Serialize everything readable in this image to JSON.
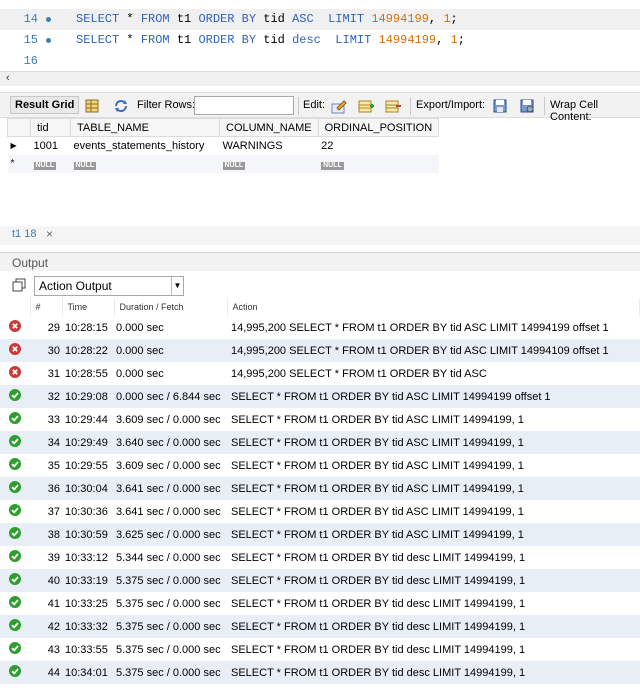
{
  "editor": {
    "lines": [
      {
        "num": "14",
        "dot": true,
        "parts": [
          {
            "t": "SELECT",
            "c": "kw"
          },
          {
            "t": " * ",
            "c": ""
          },
          {
            "t": "FROM",
            "c": "kw"
          },
          {
            "t": " t1 ",
            "c": ""
          },
          {
            "t": "ORDER BY",
            "c": "kw"
          },
          {
            "t": " tid ",
            "c": ""
          },
          {
            "t": "ASC",
            "c": "kw"
          },
          {
            "t": "  ",
            "c": ""
          },
          {
            "t": "LIMIT",
            "c": "kw"
          },
          {
            "t": " ",
            "c": ""
          },
          {
            "t": "14994199",
            "c": "num"
          },
          {
            "t": ", ",
            "c": ""
          },
          {
            "t": "1",
            "c": "num"
          },
          {
            "t": ";",
            "c": ""
          }
        ]
      },
      {
        "num": "15",
        "dot": true,
        "parts": [
          {
            "t": "SELECT",
            "c": "kw"
          },
          {
            "t": " * ",
            "c": ""
          },
          {
            "t": "FROM",
            "c": "kw"
          },
          {
            "t": " t1 ",
            "c": ""
          },
          {
            "t": "ORDER BY",
            "c": "kw"
          },
          {
            "t": " tid ",
            "c": ""
          },
          {
            "t": "desc",
            "c": "kw"
          },
          {
            "t": "  ",
            "c": ""
          },
          {
            "t": "LIMIT",
            "c": "kw"
          },
          {
            "t": " ",
            "c": ""
          },
          {
            "t": "14994199",
            "c": "num"
          },
          {
            "t": ", ",
            "c": ""
          },
          {
            "t": "1",
            "c": "num"
          },
          {
            "t": ";",
            "c": ""
          }
        ]
      },
      {
        "num": "16",
        "dot": false,
        "parts": []
      }
    ]
  },
  "result_toolbar": {
    "result_grid": "Result Grid",
    "filter_rows": "Filter Rows:",
    "edit": "Edit:",
    "export_import": "Export/Import:",
    "wrap": "Wrap Cell Content:"
  },
  "grid": {
    "columns": [
      "tid",
      "TABLE_NAME",
      "COLUMN_NAME",
      "ORDINAL_POSITION"
    ],
    "rows": [
      [
        "1001",
        "events_statements_history",
        "WARNINGS",
        "22"
      ]
    ],
    "null_label": "NULL"
  },
  "result_tab": {
    "label": "t1 18",
    "close": "×"
  },
  "output": {
    "title": "Output",
    "selector": "Action Output",
    "columns": [
      "#",
      "Time",
      "Duration / Fetch",
      "Action"
    ],
    "rows": [
      {
        "status": "error",
        "idx": "29",
        "time": "10:28:15",
        "dur": "0.000 sec",
        "action": "14,995,200  SELECT * FROM t1 ORDER BY tid ASC  LIMIT 14994199 offset 1"
      },
      {
        "status": "error",
        "idx": "30",
        "time": "10:28:22",
        "dur": "0.000 sec",
        "action": "14,995,200  SELECT * FROM t1 ORDER BY tid ASC  LIMIT 14994109 offset 1"
      },
      {
        "status": "error",
        "idx": "31",
        "time": "10:28:55",
        "dur": "0.000 sec",
        "action": "14,995,200  SELECT * FROM t1 ORDER BY tid ASC"
      },
      {
        "status": "ok",
        "idx": "32",
        "time": "10:29:08",
        "dur": "0.000 sec / 6.844 sec",
        "action": "SELECT * FROM t1 ORDER BY tid ASC  LIMIT 14994199 offset 1"
      },
      {
        "status": "ok",
        "idx": "33",
        "time": "10:29:44",
        "dur": "3.609 sec / 0.000 sec",
        "action": "SELECT * FROM t1 ORDER BY tid ASC  LIMIT 14994199, 1"
      },
      {
        "status": "ok",
        "idx": "34",
        "time": "10:29:49",
        "dur": "3.640 sec / 0.000 sec",
        "action": "SELECT * FROM t1 ORDER BY tid ASC  LIMIT 14994199, 1"
      },
      {
        "status": "ok",
        "idx": "35",
        "time": "10:29:55",
        "dur": "3.609 sec / 0.000 sec",
        "action": "SELECT * FROM t1 ORDER BY tid ASC  LIMIT 14994199, 1"
      },
      {
        "status": "ok",
        "idx": "36",
        "time": "10:30:04",
        "dur": "3.641 sec / 0.000 sec",
        "action": "SELECT * FROM t1 ORDER BY tid ASC  LIMIT 14994199, 1"
      },
      {
        "status": "ok",
        "idx": "37",
        "time": "10:30:36",
        "dur": "3.641 sec / 0.000 sec",
        "action": "SELECT * FROM t1 ORDER BY tid ASC  LIMIT 14994199, 1"
      },
      {
        "status": "ok",
        "idx": "38",
        "time": "10:30:59",
        "dur": "3.625 sec / 0.000 sec",
        "action": "SELECT * FROM t1 ORDER BY tid ASC  LIMIT 14994199, 1"
      },
      {
        "status": "ok",
        "idx": "39",
        "time": "10:33:12",
        "dur": "5.344 sec / 0.000 sec",
        "action": "SELECT * FROM t1 ORDER BY tid desc  LIMIT 14994199, 1"
      },
      {
        "status": "ok",
        "idx": "40",
        "time": "10:33:19",
        "dur": "5.375 sec / 0.000 sec",
        "action": "SELECT * FROM t1 ORDER BY tid desc  LIMIT 14994199, 1"
      },
      {
        "status": "ok",
        "idx": "41",
        "time": "10:33:25",
        "dur": "5.375 sec / 0.000 sec",
        "action": "SELECT * FROM t1 ORDER BY tid desc  LIMIT 14994199, 1"
      },
      {
        "status": "ok",
        "idx": "42",
        "time": "10:33:32",
        "dur": "5.375 sec / 0.000 sec",
        "action": "SELECT * FROM t1 ORDER BY tid desc  LIMIT 14994199, 1"
      },
      {
        "status": "ok",
        "idx": "43",
        "time": "10:33:55",
        "dur": "5.375 sec / 0.000 sec",
        "action": "SELECT * FROM t1 ORDER BY tid desc  LIMIT 14994199, 1"
      },
      {
        "status": "ok",
        "idx": "44",
        "time": "10:34:01",
        "dur": "5.375 sec / 0.000 sec",
        "action": "SELECT * FROM t1 ORDER BY tid desc  LIMIT 14994199, 1"
      }
    ]
  },
  "colors": {
    "keyword": "#2f63b8",
    "number": "#d96f00",
    "ok": "#2e9e2e",
    "error": "#c93a3a",
    "alt_row": "#e8eef6"
  }
}
